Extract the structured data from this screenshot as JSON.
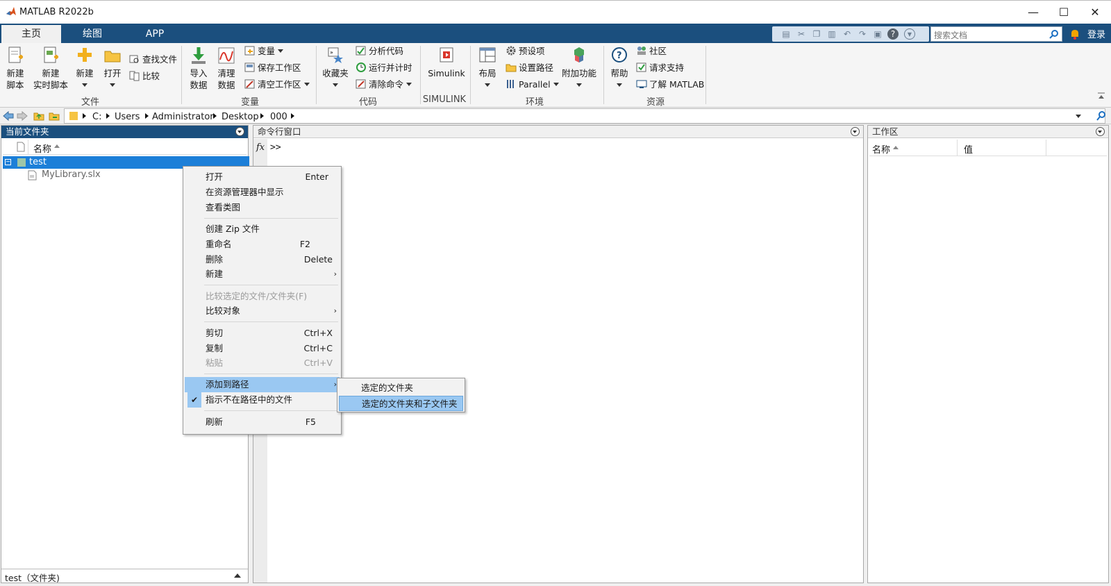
{
  "app": {
    "title": "MATLAB R2022b"
  },
  "window_controls": {
    "minimize": "—",
    "maximize": "☐",
    "close": "✕"
  },
  "tabs": [
    {
      "label": "主页",
      "active": true
    },
    {
      "label": "绘图",
      "active": false
    },
    {
      "label": "APP",
      "active": false
    }
  ],
  "search": {
    "placeholder": "搜索文档"
  },
  "login_label": "登录",
  "ribbon": {
    "file": {
      "new_script": [
        "新建",
        "脚本"
      ],
      "new_live_script": [
        "新建",
        "实时脚本"
      ],
      "new": "新建",
      "open": "打开",
      "find_files": "查找文件",
      "compare": "比较",
      "group_label": "文件"
    },
    "variable": {
      "import": [
        "导入",
        "数据"
      ],
      "clean": [
        "清理",
        "数据"
      ],
      "variable": "变量",
      "save_workspace": "保存工作区",
      "clear_workspace": "清空工作区",
      "group_label": "变量"
    },
    "code": {
      "favorites": "收藏夹",
      "analyze": "分析代码",
      "run_time": "运行并计时",
      "clear_commands": "清除命令",
      "group_label": "代码"
    },
    "simulink": {
      "label": "Simulink",
      "group_label": "SIMULINK"
    },
    "environment": {
      "layout": "布局",
      "preferences": "预设项",
      "set_path": "设置路径",
      "parallel": "Parallel",
      "addons": "附加功能",
      "group_label": "环境"
    },
    "resources": {
      "help": "帮助",
      "community": "社区",
      "request_support": "请求支持",
      "learn_matlab": "了解 MATLAB",
      "group_label": "资源"
    }
  },
  "address": {
    "crumbs": [
      "C:",
      "Users",
      "Administrator",
      "Desktop",
      "000"
    ]
  },
  "current_folder": {
    "title": "当前文件夹",
    "column_name": "名称",
    "items": [
      {
        "name": "test",
        "type": "folder",
        "selected": true
      },
      {
        "name": "MyLibrary.slx",
        "type": "file",
        "selected": false
      }
    ],
    "status": "test（文件夹)"
  },
  "command_window": {
    "title": "命令行窗口",
    "fx": "fx",
    "prompt": ">>"
  },
  "workspace": {
    "title": "工作区",
    "col_name": "名称",
    "col_value": "值"
  },
  "context_menu": {
    "items": [
      {
        "label": "打开",
        "shortcut": "Enter"
      },
      {
        "label": "在资源管理器中显示",
        "shortcut": ""
      },
      {
        "label": "查看类图",
        "shortcut": ""
      },
      {
        "label": "创建 Zip 文件",
        "shortcut": ""
      },
      {
        "label": "重命名",
        "shortcut": "F2"
      },
      {
        "label": "删除",
        "shortcut": "Delete"
      },
      {
        "label": "新建",
        "shortcut": "›"
      },
      {
        "label": "比较选定的文件/文件夹(F)",
        "shortcut": ""
      },
      {
        "label": "比较对象",
        "shortcut": "›"
      },
      {
        "label": "剪切",
        "shortcut": "Ctrl+X"
      },
      {
        "label": "复制",
        "shortcut": "Ctrl+C"
      },
      {
        "label": "粘贴",
        "shortcut": "Ctrl+V"
      },
      {
        "label": "添加到路径",
        "shortcut": "›"
      },
      {
        "label": "指示不在路径中的文件",
        "shortcut": "",
        "checked": true
      },
      {
        "label": "刷新",
        "shortcut": "F5"
      }
    ],
    "submenu": [
      {
        "label": "选定的文件夹"
      },
      {
        "label": "选定的文件夹和子文件夹"
      }
    ]
  },
  "colors": {
    "accent": "#1b4f7e",
    "highlight": "#9ac8f2",
    "selection": "#1c7fd8"
  }
}
